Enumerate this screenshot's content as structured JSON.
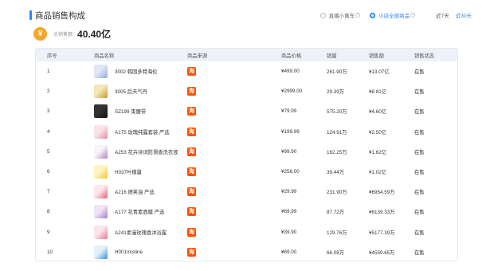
{
  "header": {
    "title": "商品销售构成",
    "filters": [
      {
        "label": "直播小黄车",
        "active": false
      },
      {
        "label": "小店全部商品",
        "active": true
      }
    ],
    "periods": [
      {
        "label": "近7天",
        "active": false
      },
      {
        "label": "近30天",
        "active": true
      }
    ]
  },
  "summary": {
    "coin_symbol": "¥",
    "label": "总销售额",
    "value": "40.40亿"
  },
  "table": {
    "columns": [
      "序号",
      "商品名称",
      "商品来源",
      "商品价格",
      "销量",
      "销售额",
      "销售状态"
    ],
    "source_glyph": "淘",
    "rows": [
      {
        "index": "1",
        "name": "3002 韩国多特海伦",
        "price": "¥499.00",
        "qty": "261.90万",
        "sales": "¥13.07亿",
        "status": "在售",
        "thumb_colors": [
          "#dfe6f7",
          "#9aa9d6"
        ]
      },
      {
        "index": "2",
        "name": "3005 后天气丹",
        "price": "¥2999.00",
        "qty": "29.39万",
        "sales": "¥8.81亿",
        "status": "在售",
        "thumb_colors": [
          "#f3e6b8",
          "#c79a2c"
        ]
      },
      {
        "index": "3",
        "name": "SZ199 束腰带",
        "price": "¥79.99",
        "qty": "575.20万",
        "sales": "¥4.60亿",
        "status": "在售",
        "thumb_colors": [
          "#333333",
          "#111111"
        ]
      },
      {
        "index": "4",
        "name": "A175 玫瑰纯露套装 严选",
        "price": "¥199.99",
        "qty": "124.91万",
        "sales": "¥2.50亿",
        "status": "在售",
        "thumb_colors": [
          "#fbe3ea",
          "#e58aa3"
        ]
      },
      {
        "index": "5",
        "name": "A253 花卉诗词防滑香洗衣液",
        "price": "¥99.90",
        "qty": "162.25万",
        "sales": "¥1.62亿",
        "status": "在售",
        "thumb_colors": [
          "#f5f5f5",
          "#b080d0"
        ]
      },
      {
        "index": "6",
        "name": "H037叶模量",
        "price": "¥258.00",
        "qty": "39.44万",
        "sales": "¥1.02亿",
        "status": "在售",
        "thumb_colors": [
          "#fff3c4",
          "#f2c230"
        ]
      },
      {
        "index": "7",
        "name": "A216 德芙油 严选",
        "price": "¥29.99",
        "qty": "231.90万",
        "sales": "¥6954.59万",
        "status": "在售",
        "thumb_colors": [
          "#fde6ec",
          "#e0607a"
        ]
      },
      {
        "index": "8",
        "name": "A177 花青素面膜 严选",
        "price": "¥69.99",
        "qty": "87.72万",
        "sales": "¥6139.33万",
        "status": "在售",
        "thumb_colors": [
          "#efe4f6",
          "#a27cc8"
        ]
      },
      {
        "index": "9",
        "name": "A241柔漫玫瑰香沐浴露",
        "price": "¥39.90",
        "qty": "129.76万",
        "sales": "¥5177.39万",
        "status": "在售",
        "thumb_colors": [
          "#fde4ea",
          "#e27a93"
        ]
      },
      {
        "index": "10",
        "name": "H001mistine",
        "price": "¥69.00",
        "qty": "66.08万",
        "sales": "¥4559.65万",
        "status": "在售",
        "thumb_colors": [
          "#e4f1fb",
          "#3b8fd6"
        ]
      }
    ]
  },
  "colors": {
    "accent": "#2f86f6",
    "coin": "#f4a72a",
    "taobao": "#ff5000",
    "table_header_bg": "#eef2f8"
  }
}
